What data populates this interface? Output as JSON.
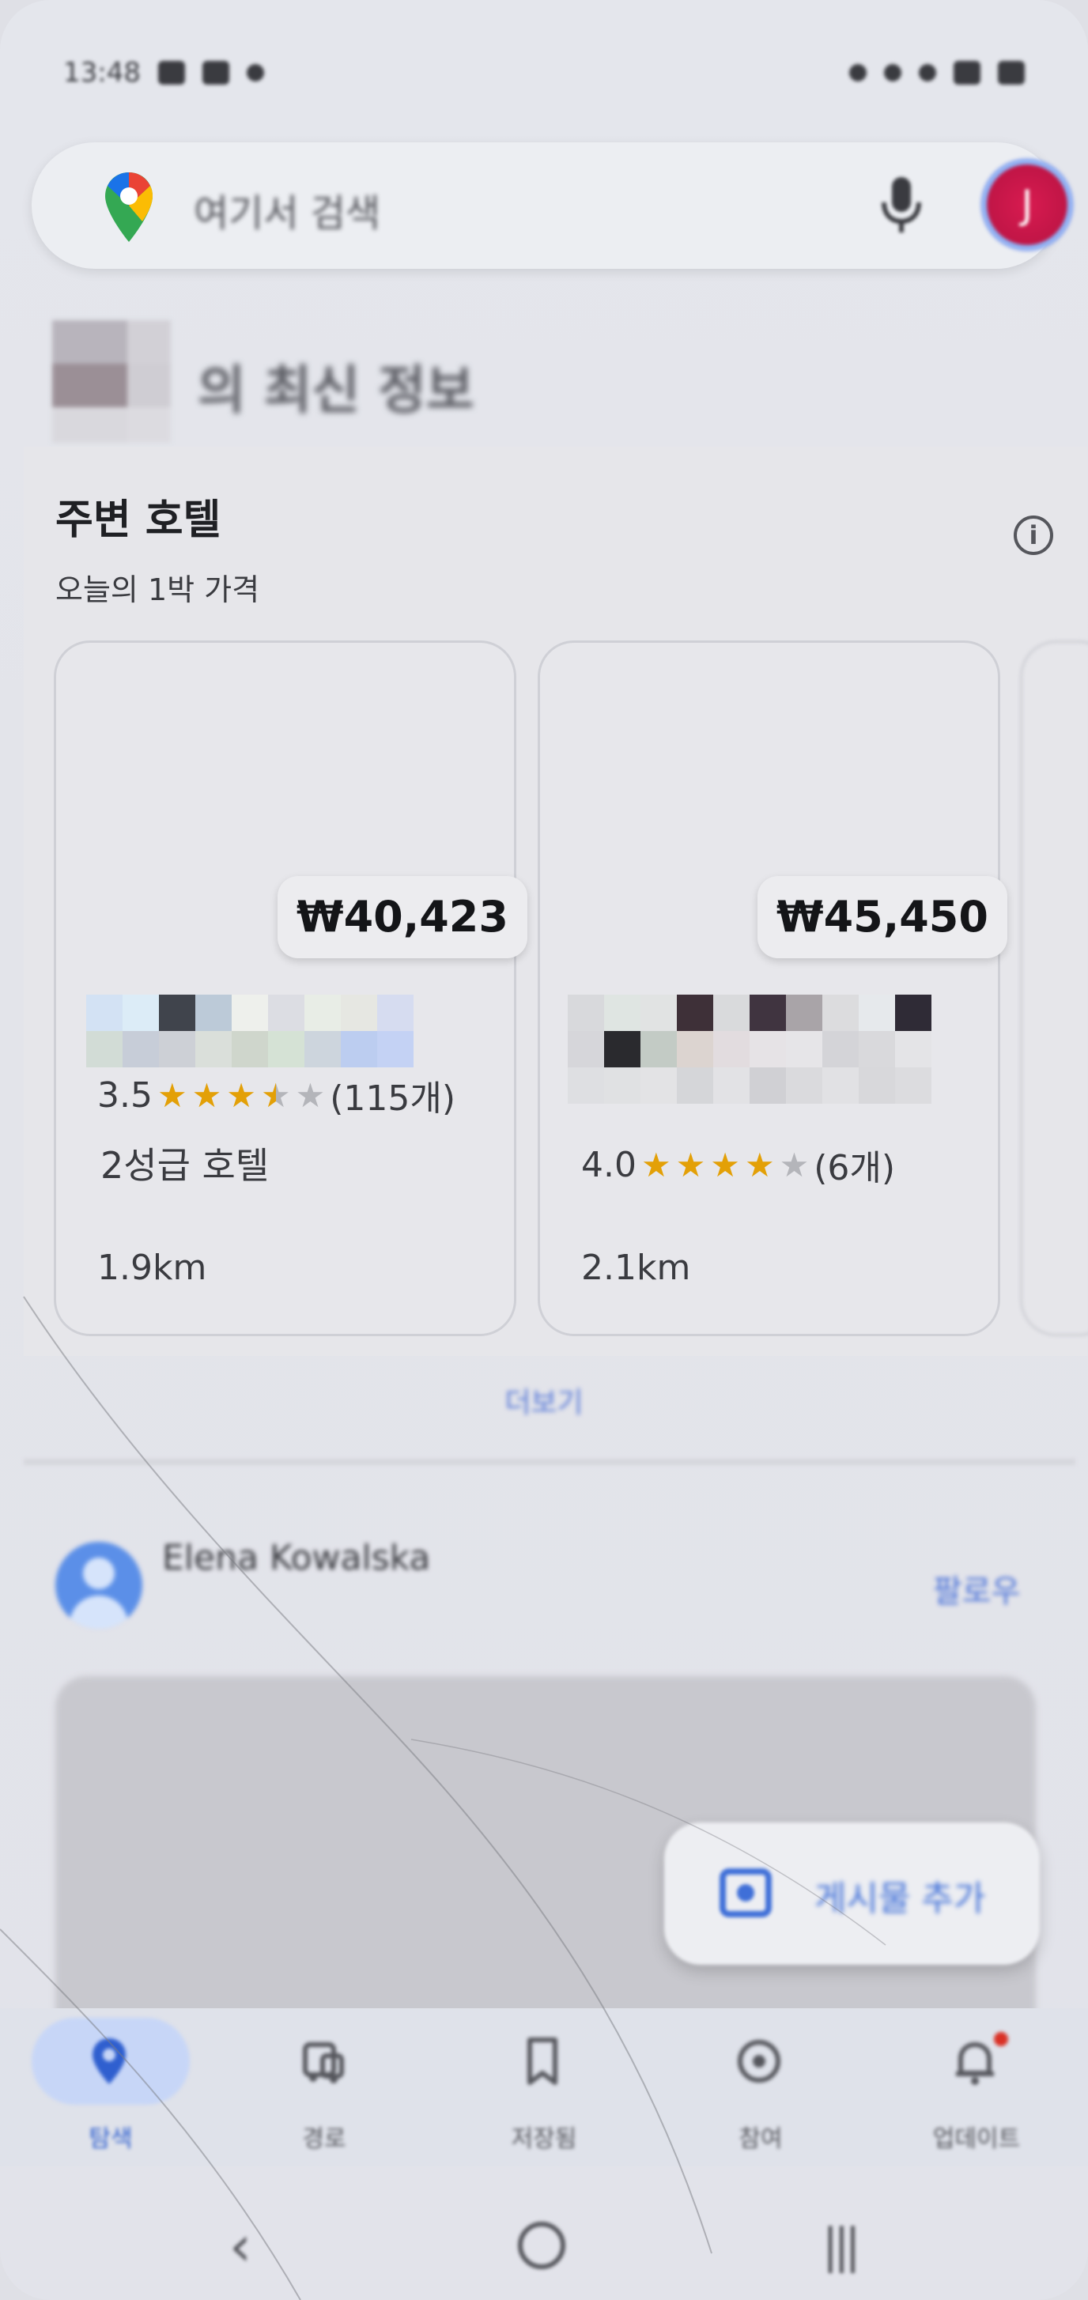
{
  "status_bar": {
    "time": "13:48"
  },
  "search": {
    "placeholder": "여기서 검색"
  },
  "account": {
    "initial": "J"
  },
  "section": {
    "title": "의 최신 정보"
  },
  "hotels": {
    "title": "주변 호텔",
    "subtitle": "오늘의 1박 가격",
    "cards": [
      {
        "price": "₩40,423",
        "rating": "3.5",
        "stars": 3.5,
        "reviews": "(115개)",
        "type": "2성급 호텔",
        "distance": "1.9km"
      },
      {
        "price": "₩45,450",
        "rating": "4.0",
        "stars": 4.0,
        "reviews": "(6개)",
        "type": "",
        "distance": "2.1km"
      }
    ],
    "more": "더보기"
  },
  "post": {
    "author": "Elena Kowalska",
    "follow": "팔로우"
  },
  "fab": {
    "label": "게시물 추가"
  },
  "nav": {
    "items": [
      {
        "label": "탐색",
        "icon": "location-pin-icon",
        "active": true
      },
      {
        "label": "경로",
        "icon": "car-icon",
        "active": false
      },
      {
        "label": "저장됨",
        "icon": "bookmark-icon",
        "active": false
      },
      {
        "label": "참여",
        "icon": "contribute-icon",
        "active": false
      },
      {
        "label": "업데이트",
        "icon": "bell-icon",
        "active": false
      }
    ]
  },
  "colors": {
    "accent": "#2f5fcf",
    "star": "#e3a007",
    "brand_red": "#d81b50"
  }
}
